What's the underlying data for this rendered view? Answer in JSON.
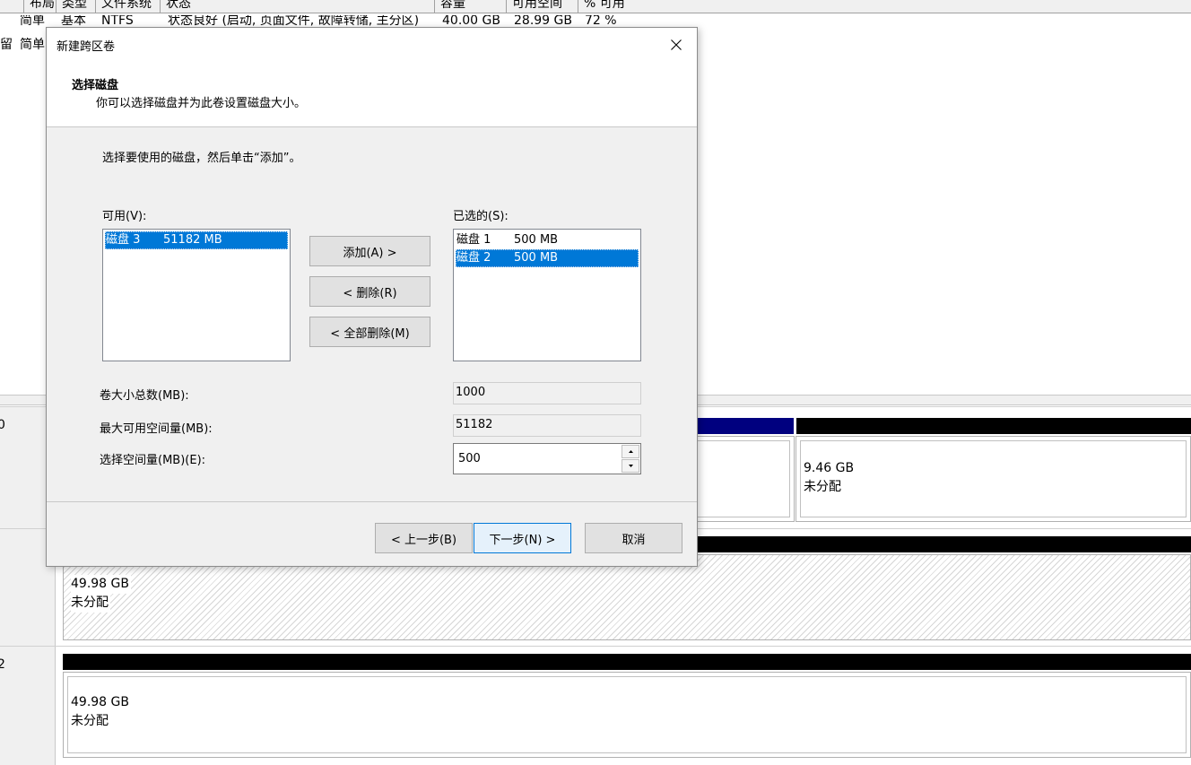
{
  "volume_list": {
    "columns": [
      "布局",
      "类型",
      "文件系统",
      "状态",
      "容量",
      "可用空间",
      "% 可用"
    ],
    "rows": [
      {
        "prefix": "",
        "layout": "简单",
        "type": "基本",
        "fs": "NTFS",
        "status": "状态良好 (启动, 页面文件, 故障转储, 主分区)",
        "capacity": "40.00 GB",
        "free": "28.99 GB",
        "pct": "72 %"
      },
      {
        "prefix": "留",
        "layout": "简单",
        "type": "",
        "fs": "",
        "status": "",
        "capacity": "",
        "free": "",
        "pct": ""
      }
    ]
  },
  "disk_map": {
    "disk0": {
      "label": "0",
      "partition_size": "9.46 GB",
      "partition_status": "未分配"
    },
    "disk1": {
      "label": "",
      "partition_size": "49.98 GB",
      "partition_status": "未分配"
    },
    "disk2": {
      "label": "2",
      "partition_size": "49.98 GB",
      "partition_status": "未分配"
    },
    "colors": {
      "primary_strip": "#00007f",
      "unallocated_strip": "#000000"
    }
  },
  "dialog": {
    "title": "新建跨区卷",
    "header_title": "选择磁盘",
    "header_subtitle": "你可以选择磁盘并为此卷设置磁盘大小。",
    "instruction": "选择要使用的磁盘，然后单击“添加”。",
    "available_label": "可用(V):",
    "available_items": [
      {
        "disk": "磁盘 3",
        "size": "51182 MB",
        "selected": true
      }
    ],
    "selected_label": "已选的(S):",
    "selected_items": [
      {
        "disk": "磁盘 1",
        "size": "500 MB",
        "selected": false
      },
      {
        "disk": "磁盘 2",
        "size": "500 MB",
        "selected": true
      }
    ],
    "add_button": "添加(A) >",
    "remove_button": "< 删除(R)",
    "remove_all_button": "< 全部删除(M)",
    "total_size_label": "卷大小总数(MB):",
    "total_size_value": "1000",
    "max_space_label": "最大可用空间量(MB):",
    "max_space_value": "51182",
    "select_space_label": "选择空间量(MB)(E):",
    "select_space_value": "500",
    "back_button": "< 上一步(B)",
    "next_button": "下一步(N) >",
    "cancel_button": "取消",
    "selection_color": "#0078d7"
  }
}
